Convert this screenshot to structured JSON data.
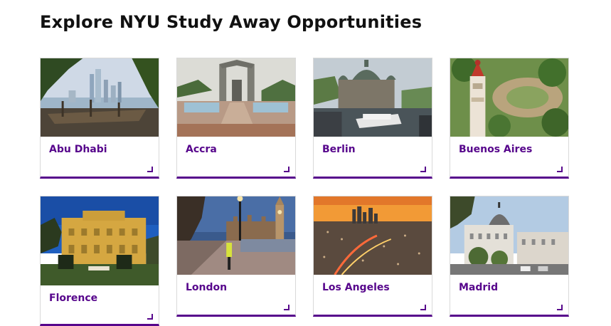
{
  "page": {
    "title": "Explore NYU Study Away Opportunities"
  },
  "cards": [
    {
      "label": "Abu Dhabi"
    },
    {
      "label": "Accra"
    },
    {
      "label": "Berlin"
    },
    {
      "label": "Buenos Aires"
    },
    {
      "label": "Florence"
    },
    {
      "label": "London"
    },
    {
      "label": "Los Angeles"
    },
    {
      "label": "Madrid"
    }
  ],
  "colors": {
    "accent": "#57068c",
    "title": "#111111",
    "border": "#d9d9d9"
  }
}
